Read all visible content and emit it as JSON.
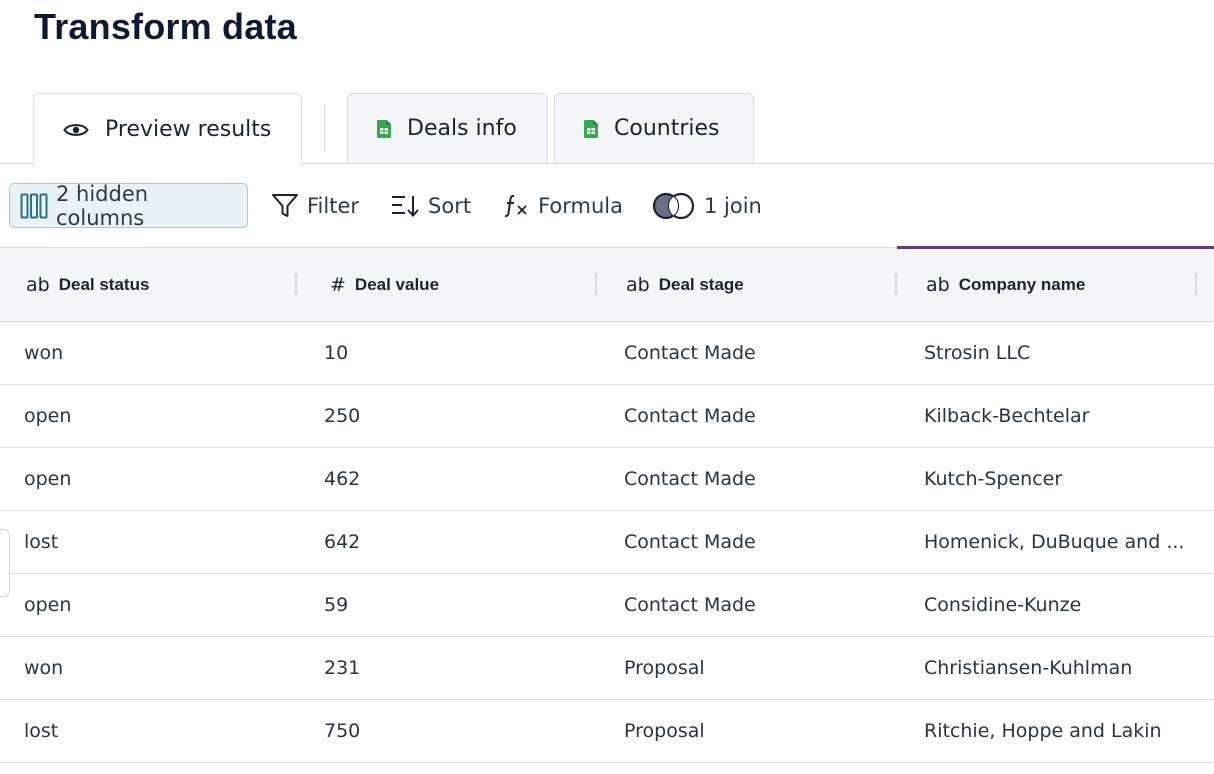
{
  "page": {
    "title": "Transform data"
  },
  "tabs": [
    {
      "label": "Preview results",
      "icon": "eye-icon",
      "active": true
    },
    {
      "label": "Deals info",
      "icon": "google-sheets-icon",
      "active": false
    },
    {
      "label": "Countries",
      "icon": "google-sheets-icon",
      "active": false
    }
  ],
  "toolbar": {
    "hidden_columns": "2 hidden columns",
    "filter": "Filter",
    "sort": "Sort",
    "formula": "Formula",
    "join": "1 join"
  },
  "table": {
    "columns": [
      {
        "type_icon": "ab",
        "label": "Deal status"
      },
      {
        "type_icon": "#",
        "label": "Deal value"
      },
      {
        "type_icon": "ab",
        "label": "Deal stage"
      },
      {
        "type_icon": "ab",
        "label": "Company name"
      }
    ],
    "rows": [
      [
        "won",
        "10",
        "Contact Made",
        "Strosin LLC"
      ],
      [
        "open",
        "250",
        "Contact Made",
        "Kilback-Bechtelar"
      ],
      [
        "open",
        "462",
        "Contact Made",
        "Kutch-Spencer"
      ],
      [
        "lost",
        "642",
        "Contact Made",
        "Homenick, DuBuque and ..."
      ],
      [
        "open",
        "59",
        "Contact Made",
        "Considine-Kunze"
      ],
      [
        "won",
        "231",
        "Proposal",
        "Christiansen-Kuhlman"
      ],
      [
        "lost",
        "750",
        "Proposal",
        "Ritchie, Hoppe and Lakin"
      ]
    ]
  },
  "colors": {
    "active_column_accent": "#5b3e8f",
    "sheets_green": "#34a853",
    "hidden_columns_bg": "#e9f3f7"
  }
}
